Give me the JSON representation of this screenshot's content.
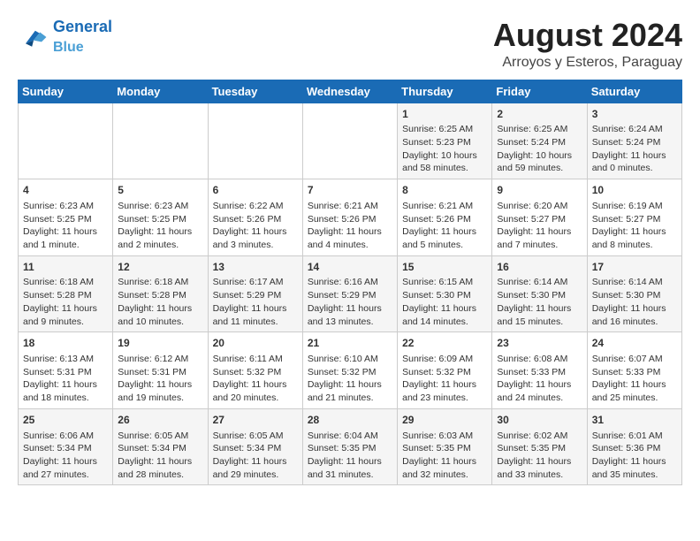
{
  "header": {
    "logo_line1": "General",
    "logo_line2": "Blue",
    "month": "August 2024",
    "location": "Arroyos y Esteros, Paraguay"
  },
  "weekdays": [
    "Sunday",
    "Monday",
    "Tuesday",
    "Wednesday",
    "Thursday",
    "Friday",
    "Saturday"
  ],
  "weeks": [
    [
      {
        "day": "",
        "info": ""
      },
      {
        "day": "",
        "info": ""
      },
      {
        "day": "",
        "info": ""
      },
      {
        "day": "",
        "info": ""
      },
      {
        "day": "1",
        "info": "Sunrise: 6:25 AM\nSunset: 5:23 PM\nDaylight: 10 hours and 58 minutes."
      },
      {
        "day": "2",
        "info": "Sunrise: 6:25 AM\nSunset: 5:24 PM\nDaylight: 10 hours and 59 minutes."
      },
      {
        "day": "3",
        "info": "Sunrise: 6:24 AM\nSunset: 5:24 PM\nDaylight: 11 hours and 0 minutes."
      }
    ],
    [
      {
        "day": "4",
        "info": "Sunrise: 6:23 AM\nSunset: 5:25 PM\nDaylight: 11 hours and 1 minute."
      },
      {
        "day": "5",
        "info": "Sunrise: 6:23 AM\nSunset: 5:25 PM\nDaylight: 11 hours and 2 minutes."
      },
      {
        "day": "6",
        "info": "Sunrise: 6:22 AM\nSunset: 5:26 PM\nDaylight: 11 hours and 3 minutes."
      },
      {
        "day": "7",
        "info": "Sunrise: 6:21 AM\nSunset: 5:26 PM\nDaylight: 11 hours and 4 minutes."
      },
      {
        "day": "8",
        "info": "Sunrise: 6:21 AM\nSunset: 5:26 PM\nDaylight: 11 hours and 5 minutes."
      },
      {
        "day": "9",
        "info": "Sunrise: 6:20 AM\nSunset: 5:27 PM\nDaylight: 11 hours and 7 minutes."
      },
      {
        "day": "10",
        "info": "Sunrise: 6:19 AM\nSunset: 5:27 PM\nDaylight: 11 hours and 8 minutes."
      }
    ],
    [
      {
        "day": "11",
        "info": "Sunrise: 6:18 AM\nSunset: 5:28 PM\nDaylight: 11 hours and 9 minutes."
      },
      {
        "day": "12",
        "info": "Sunrise: 6:18 AM\nSunset: 5:28 PM\nDaylight: 11 hours and 10 minutes."
      },
      {
        "day": "13",
        "info": "Sunrise: 6:17 AM\nSunset: 5:29 PM\nDaylight: 11 hours and 11 minutes."
      },
      {
        "day": "14",
        "info": "Sunrise: 6:16 AM\nSunset: 5:29 PM\nDaylight: 11 hours and 13 minutes."
      },
      {
        "day": "15",
        "info": "Sunrise: 6:15 AM\nSunset: 5:30 PM\nDaylight: 11 hours and 14 minutes."
      },
      {
        "day": "16",
        "info": "Sunrise: 6:14 AM\nSunset: 5:30 PM\nDaylight: 11 hours and 15 minutes."
      },
      {
        "day": "17",
        "info": "Sunrise: 6:14 AM\nSunset: 5:30 PM\nDaylight: 11 hours and 16 minutes."
      }
    ],
    [
      {
        "day": "18",
        "info": "Sunrise: 6:13 AM\nSunset: 5:31 PM\nDaylight: 11 hours and 18 minutes."
      },
      {
        "day": "19",
        "info": "Sunrise: 6:12 AM\nSunset: 5:31 PM\nDaylight: 11 hours and 19 minutes."
      },
      {
        "day": "20",
        "info": "Sunrise: 6:11 AM\nSunset: 5:32 PM\nDaylight: 11 hours and 20 minutes."
      },
      {
        "day": "21",
        "info": "Sunrise: 6:10 AM\nSunset: 5:32 PM\nDaylight: 11 hours and 21 minutes."
      },
      {
        "day": "22",
        "info": "Sunrise: 6:09 AM\nSunset: 5:32 PM\nDaylight: 11 hours and 23 minutes."
      },
      {
        "day": "23",
        "info": "Sunrise: 6:08 AM\nSunset: 5:33 PM\nDaylight: 11 hours and 24 minutes."
      },
      {
        "day": "24",
        "info": "Sunrise: 6:07 AM\nSunset: 5:33 PM\nDaylight: 11 hours and 25 minutes."
      }
    ],
    [
      {
        "day": "25",
        "info": "Sunrise: 6:06 AM\nSunset: 5:34 PM\nDaylight: 11 hours and 27 minutes."
      },
      {
        "day": "26",
        "info": "Sunrise: 6:05 AM\nSunset: 5:34 PM\nDaylight: 11 hours and 28 minutes."
      },
      {
        "day": "27",
        "info": "Sunrise: 6:05 AM\nSunset: 5:34 PM\nDaylight: 11 hours and 29 minutes."
      },
      {
        "day": "28",
        "info": "Sunrise: 6:04 AM\nSunset: 5:35 PM\nDaylight: 11 hours and 31 minutes."
      },
      {
        "day": "29",
        "info": "Sunrise: 6:03 AM\nSunset: 5:35 PM\nDaylight: 11 hours and 32 minutes."
      },
      {
        "day": "30",
        "info": "Sunrise: 6:02 AM\nSunset: 5:35 PM\nDaylight: 11 hours and 33 minutes."
      },
      {
        "day": "31",
        "info": "Sunrise: 6:01 AM\nSunset: 5:36 PM\nDaylight: 11 hours and 35 minutes."
      }
    ]
  ]
}
